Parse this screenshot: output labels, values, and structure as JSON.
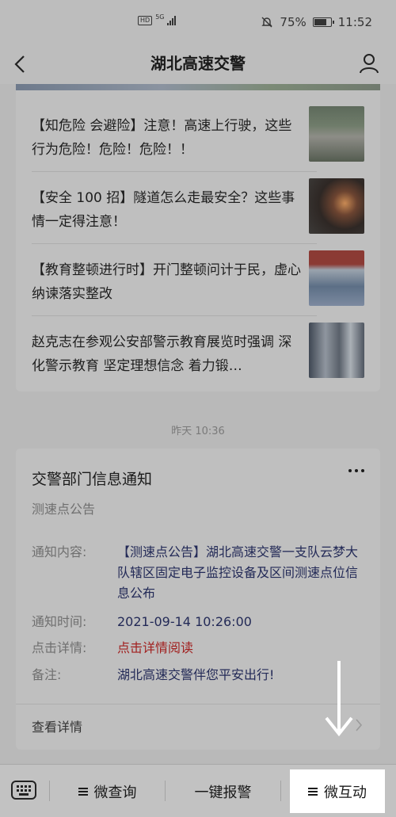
{
  "status_bar": {
    "battery": "75%",
    "time": "11:52",
    "network": "5G"
  },
  "nav": {
    "title": "湖北高速交警"
  },
  "news": [
    {
      "title": "【知危险 会避险】注意！高速上行驶，这些行为危险！危险！危险！！"
    },
    {
      "title": "【安全 100 招】隧道怎么走最安全？这些事情一定得注意！"
    },
    {
      "title": "【教育整顿进行时】开门整顿问计于民，虚心纳谏落实整改"
    },
    {
      "title": "赵克志在参观公安部警示教育展览时强调 深化警示教育 坚定理想信念 着力锻…"
    }
  ],
  "timestamp": "昨天 10:36",
  "notice": {
    "title": "交警部门信息通知",
    "subtitle": "测速点公告",
    "rows": [
      {
        "label": "通知内容:",
        "value": "【测速点公告】湖北高速交警一支队云梦大队辖区固定电子监控设备及区间测速点位信息公布"
      },
      {
        "label": "通知时间:",
        "value": "2021-09-14 10:26:00"
      },
      {
        "label": "点击详情:",
        "value": "点击详情阅读"
      },
      {
        "label": "备注:",
        "value": "湖北高速交警伴您平安出行!"
      }
    ],
    "more": "查看详情"
  },
  "tabs": [
    {
      "label": "微查询"
    },
    {
      "label": "一键报警"
    },
    {
      "label": "微互动"
    }
  ],
  "colors": {
    "link_blue": "#232a57",
    "link_red": "#a1201f"
  }
}
